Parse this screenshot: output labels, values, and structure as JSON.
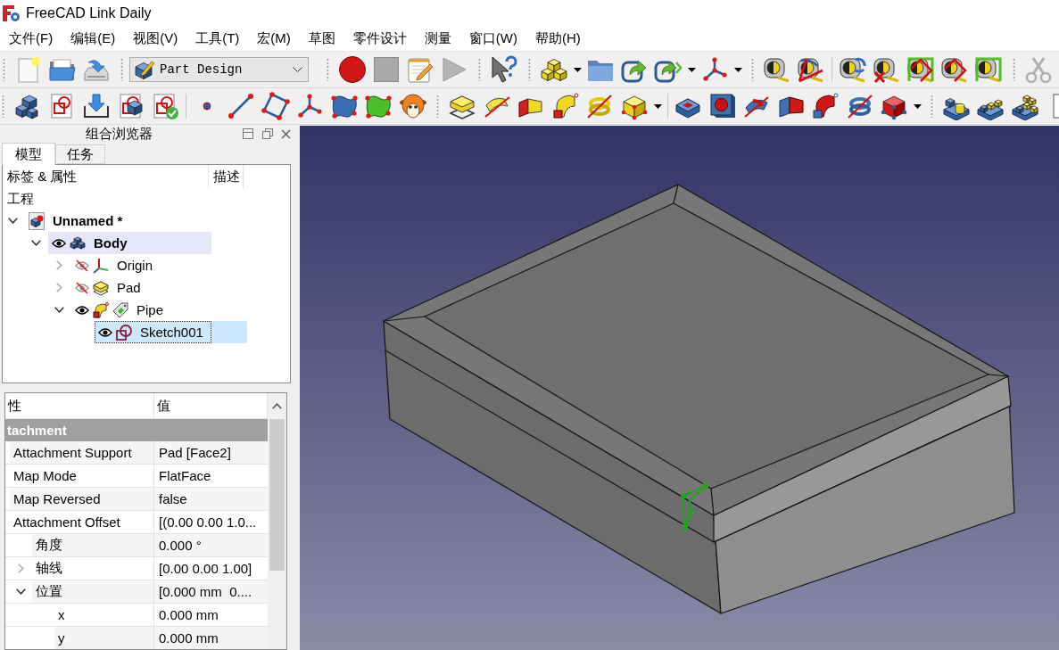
{
  "window": {
    "title": "FreeCAD Link Daily"
  },
  "menu": [
    "文件(F)",
    "编辑(E)",
    "视图(V)",
    "工具(T)",
    "宏(M)",
    "草图",
    "零件设计",
    "测量",
    "窗口(W)",
    "帮助(H)"
  ],
  "toolbar": {
    "workbench": "Part Design"
  },
  "combo_view": {
    "title": "组合浏览器",
    "tabs": [
      {
        "label": "模型",
        "selected": true
      },
      {
        "label": "任务",
        "selected": false
      }
    ],
    "tree": {
      "columns": [
        "标签 & 属性",
        "描述"
      ],
      "section": "工程",
      "items": [
        {
          "kind": "document",
          "label": "Unnamed *",
          "expanded": true,
          "active": false,
          "selected": false,
          "children": [
            {
              "kind": "body",
              "label": "Body",
              "expanded": true,
              "visible": true,
              "active": true,
              "selected": false,
              "tagged": false,
              "children": [
                {
                  "kind": "origin",
                  "label": "Origin",
                  "expanded": false,
                  "visible": false,
                  "active": false,
                  "selected": false,
                  "tagged": false
                },
                {
                  "kind": "pad",
                  "label": "Pad",
                  "expanded": false,
                  "visible": false,
                  "active": false,
                  "selected": false,
                  "tagged": false
                },
                {
                  "kind": "pipe",
                  "label": "Pipe",
                  "expanded": true,
                  "visible": true,
                  "active": false,
                  "selected": false,
                  "tagged": true,
                  "children": [
                    {
                      "kind": "sketch",
                      "label": "Sketch001",
                      "visible": true,
                      "active": false,
                      "selected": true,
                      "tagged": false
                    }
                  ]
                }
              ]
            }
          ]
        }
      ]
    }
  },
  "properties": {
    "columns": [
      "性",
      "值"
    ],
    "groups": [
      {
        "name": "tachment",
        "rows": [
          {
            "name": "Attachment Support",
            "value": "Pad [Face2]"
          },
          {
            "name": "Map Mode",
            "value": "FlatFace"
          },
          {
            "name": "Map Reversed",
            "value": "false"
          },
          {
            "name": "Attachment Offset",
            "value": "[(0.00 0.00 1.0...",
            "children": [
              {
                "name": "角度",
                "value": "0.000 °"
              },
              {
                "name": "轴线",
                "value": "[0.00 0.00 1.00]",
                "expanded": false
              },
              {
                "name": "位置",
                "value": "[0.000 mm  0....",
                "expanded": true,
                "children": [
                  {
                    "name": "x",
                    "value": "0.000 mm"
                  },
                  {
                    "name": "y",
                    "value": "0.000 mm"
                  }
                ]
              }
            ]
          }
        ]
      }
    ]
  }
}
